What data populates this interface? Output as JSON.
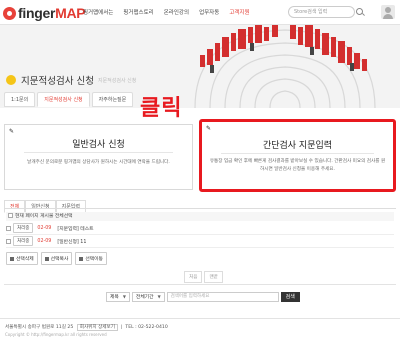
{
  "header": {
    "logo_prefix": "finger",
    "logo_suffix": "MAP",
    "nav": [
      {
        "label": "핑거맵에서는",
        "active": false
      },
      {
        "label": "핑거맵스토리",
        "active": false
      },
      {
        "label": "온라인강의",
        "active": false
      },
      {
        "label": "업무자동",
        "active": false
      },
      {
        "label": "고객지원",
        "active": true
      }
    ],
    "search_placeholder": "Store검색 입력"
  },
  "banner": {
    "title": "지문적성검사 신청",
    "subtitle": "지문적성검사 신청"
  },
  "subtabs": [
    {
      "label": "1:1문의",
      "active": false
    },
    {
      "label": "지문적성검사 신청",
      "active": true
    },
    {
      "label": "자주하는질문",
      "active": false
    }
  ],
  "click_note": "클릭",
  "cards": {
    "general": {
      "title": "일반검사 신청",
      "desc": "날개주신 문의로분 핑거맵의 상담사가 원하시는 시간대에 연락을 드립니다."
    },
    "simple": {
      "title": "간단검사 지문입력",
      "desc": "유통장 입금 확인 후에 빠른게 검사결과를 받아보실 수 있습니다. 간판검사 미요의 검사를 원하시면 일반검사 신청을 이용해 주세요."
    }
  },
  "board_tabs": [
    {
      "label": "전체",
      "active": true
    },
    {
      "label": "일반신청",
      "active": false
    },
    {
      "label": "지문입력",
      "active": false
    }
  ],
  "select_all_label": "현재 페이지 게시물 전체선택",
  "rows": [
    {
      "button": "처리중",
      "date": "02-09",
      "title": "[지문입력] 테스트"
    },
    {
      "button": "처리중",
      "date": "02-09",
      "title": "[일반신청] 11"
    }
  ],
  "actions": [
    "선택삭제",
    "선택복사",
    "선택이동"
  ],
  "pager": [
    "처음",
    "맨끝"
  ],
  "search": {
    "field_option": "제목",
    "period_option": "전체기간",
    "placeholder": "검색어를 입력하세요",
    "button": "검색"
  },
  "footer": {
    "address": "서울특별시 송파구 법원로 11길 25",
    "map_link": "회사위치 상세보기",
    "tel": "TEL : 02-522-0410",
    "copyright": "Copyright © http://fingermap.kr all rights reserved"
  },
  "colors": {
    "accent": "#e23a31",
    "highlight": "#e8191f",
    "banner_dot": "#f5c518"
  }
}
